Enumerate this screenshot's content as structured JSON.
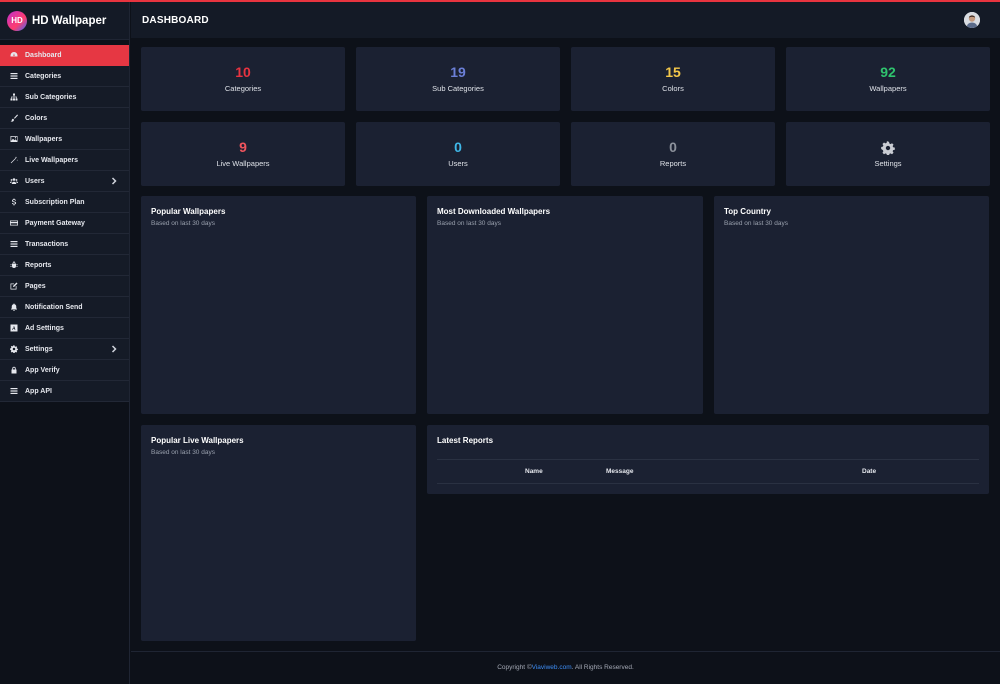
{
  "brand": {
    "logo_text": "HD",
    "name": "HD Wallpaper"
  },
  "header": {
    "title": "DASHBOARD"
  },
  "sidebar": {
    "items": [
      {
        "label": "Dashboard",
        "icon": "dashboard-icon",
        "active": true
      },
      {
        "label": "Categories",
        "icon": "list-icon"
      },
      {
        "label": "Sub Categories",
        "icon": "sitemap-icon"
      },
      {
        "label": "Colors",
        "icon": "brush-icon"
      },
      {
        "label": "Wallpapers",
        "icon": "image-icon"
      },
      {
        "label": "Live Wallpapers",
        "icon": "magic-icon"
      },
      {
        "label": "Users",
        "icon": "users-icon",
        "has_children": true
      },
      {
        "label": "Subscription Plan",
        "icon": "dollar-icon"
      },
      {
        "label": "Payment Gateway",
        "icon": "credit-card-icon"
      },
      {
        "label": "Transactions",
        "icon": "list-icon"
      },
      {
        "label": "Reports",
        "icon": "bug-icon"
      },
      {
        "label": "Pages",
        "icon": "edit-icon"
      },
      {
        "label": "Notification Send",
        "icon": "bell-icon"
      },
      {
        "label": "Ad Settings",
        "icon": "ad-icon"
      },
      {
        "label": "Settings",
        "icon": "gear-icon",
        "has_children": true
      },
      {
        "label": "App Verify",
        "icon": "lock-icon"
      },
      {
        "label": "App API",
        "icon": "api-icon"
      }
    ]
  },
  "stats": [
    {
      "value": "10",
      "label": "Categories",
      "color": "#e83340"
    },
    {
      "value": "19",
      "label": "Sub Categories",
      "color": "#6b7fd7"
    },
    {
      "value": "15",
      "label": "Colors",
      "color": "#f4c84a"
    },
    {
      "value": "92",
      "label": "Wallpapers",
      "color": "#2fc46e"
    },
    {
      "value": "9",
      "label": "Live Wallpapers",
      "color": "#f0545d"
    },
    {
      "value": "0",
      "label": "Users",
      "color": "#3fb7e8"
    },
    {
      "value": "0",
      "label": "Reports",
      "color": "#8c919b"
    },
    {
      "value": "",
      "label": "Settings",
      "icon": "gear-icon"
    }
  ],
  "panels": {
    "popular_wallpapers": {
      "title": "Popular Wallpapers",
      "subtitle": "Based on last 30 days"
    },
    "most_downloaded": {
      "title": "Most Downloaded Wallpapers",
      "subtitle": "Based on last 30 days"
    },
    "top_country": {
      "title": "Top Country",
      "subtitle": "Based on last 30 days"
    },
    "popular_live": {
      "title": "Popular Live Wallpapers",
      "subtitle": "Based on last 30 days"
    },
    "latest_reports": {
      "title": "Latest Reports",
      "columns": [
        "Name",
        "Message",
        "Date"
      ]
    }
  },
  "footer": {
    "prefix": "Copyright ©",
    "link": "Viaviweb.com",
    "suffix": ". All Rights Reserved."
  }
}
